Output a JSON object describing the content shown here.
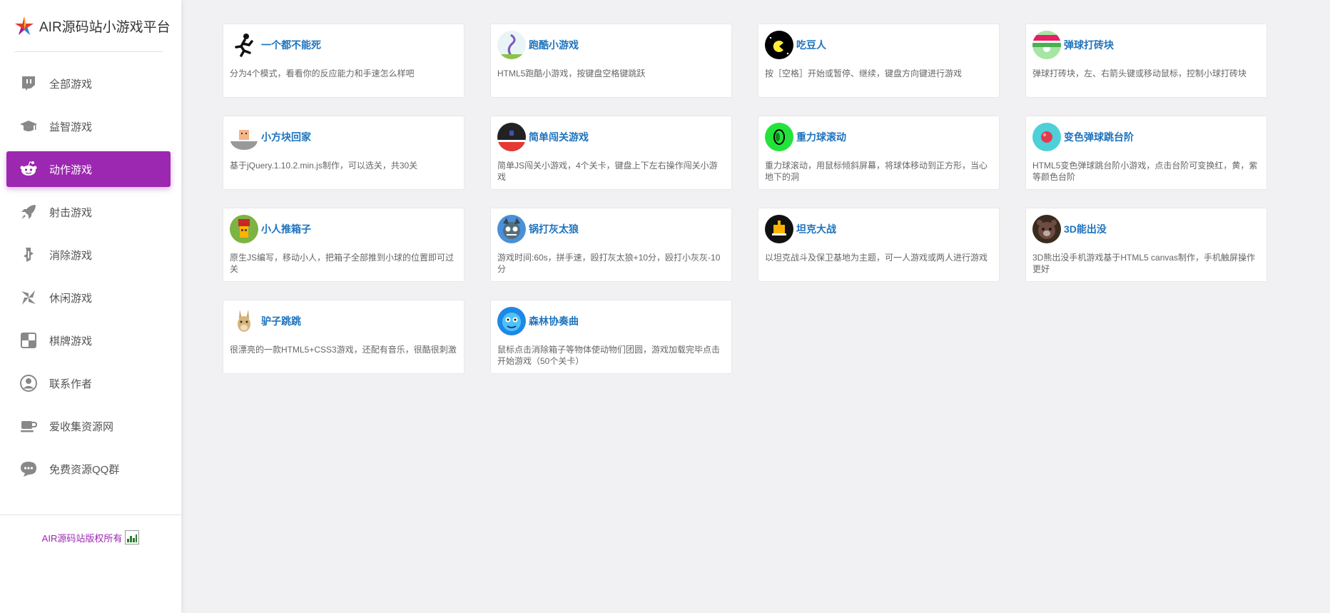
{
  "brand": {
    "title": "AIR源码站小游戏平台"
  },
  "nav": [
    {
      "label": "全部游戏",
      "icon": "twitch-icon"
    },
    {
      "label": "益智游戏",
      "icon": "graduation-cap-icon"
    },
    {
      "label": "动作游戏",
      "icon": "reddit-icon",
      "active": true
    },
    {
      "label": "射击游戏",
      "icon": "rocket-icon"
    },
    {
      "label": "消除游戏",
      "icon": "puzzle-icon"
    },
    {
      "label": "休闲游戏",
      "icon": "pinwheel-icon"
    },
    {
      "label": "棋牌游戏",
      "icon": "chessboard-icon"
    },
    {
      "label": "联系作者",
      "icon": "user-circle-icon"
    },
    {
      "label": "爱收集资源网",
      "icon": "coffee-icon"
    },
    {
      "label": "免费资源QQ群",
      "icon": "chat-icon"
    }
  ],
  "footer": {
    "copyright": "AIR源码站版权所有"
  },
  "colors": {
    "accent": "#9c27b0",
    "title": "#1e73be"
  },
  "games": [
    {
      "title": "一个都不能死",
      "desc": "分为4个模式，看看你的反应能力和手速怎么样吧",
      "icon": "runner-icon"
    },
    {
      "title": "跑酷小游戏",
      "desc": "HTML5跑酷小游戏，按键盘空格键跳跃",
      "icon": "vine-icon"
    },
    {
      "title": "吃豆人",
      "desc": "按［空格］开始或暂停、继续，键盘方向键进行游戏",
      "icon": "pacman-icon"
    },
    {
      "title": "弹球打砖块",
      "desc": "弹球打砖块，左、右箭头键或移动鼠标，控制小球打砖块",
      "icon": "brick-ball-icon"
    },
    {
      "title": "小方块回家",
      "desc": "基于jQuery.1.10.2.min.js制作，可以选关，共30关",
      "icon": "cube-home-icon"
    },
    {
      "title": "简单闯关游戏",
      "desc": "简单JS闯关小游戏，4个关卡，键盘上下左右操作闯关小游戏",
      "icon": "platform-icon"
    },
    {
      "title": "重力球滚动",
      "desc": "重力球滚动，用鼠标倾斜屏幕，将球体移动到正方形，当心地下的洞",
      "icon": "gravity-ball-icon"
    },
    {
      "title": "变色弹球跳台阶",
      "desc": "HTML5变色弹球跳台阶小游戏，点击台阶可变换红，黄，紫等颜色台阶",
      "icon": "color-ball-icon"
    },
    {
      "title": "小人推箱子",
      "desc": "原生JS编写，移动小人，把箱子全部推到小球的位置即可过关",
      "icon": "sokoban-icon"
    },
    {
      "title": "锅打灰太狼",
      "desc": "游戏时间:60s，拼手速，殴打灰太狼+10分，殴打小灰灰-10分",
      "icon": "wolf-icon"
    },
    {
      "title": "坦克大战",
      "desc": "以坦克战斗及保卫基地为主题，可一人游戏或两人进行游戏",
      "icon": "tank-icon"
    },
    {
      "title": "3D能出没",
      "desc": "3D熊出没手机游戏基于HTML5 canvas制作，手机触屏操作更好",
      "icon": "bear-icon"
    },
    {
      "title": "驴子跳跳",
      "desc": "很漂亮的一款HTML5+CSS3游戏，还配有音乐，很酷很刺激",
      "icon": "donkey-icon"
    },
    {
      "title": "森林协奏曲",
      "desc": "鼠标点击消除箱子等物体使动物们团圆，游戏加载完毕点击开始游戏（50个关卡）",
      "icon": "forest-icon"
    }
  ]
}
